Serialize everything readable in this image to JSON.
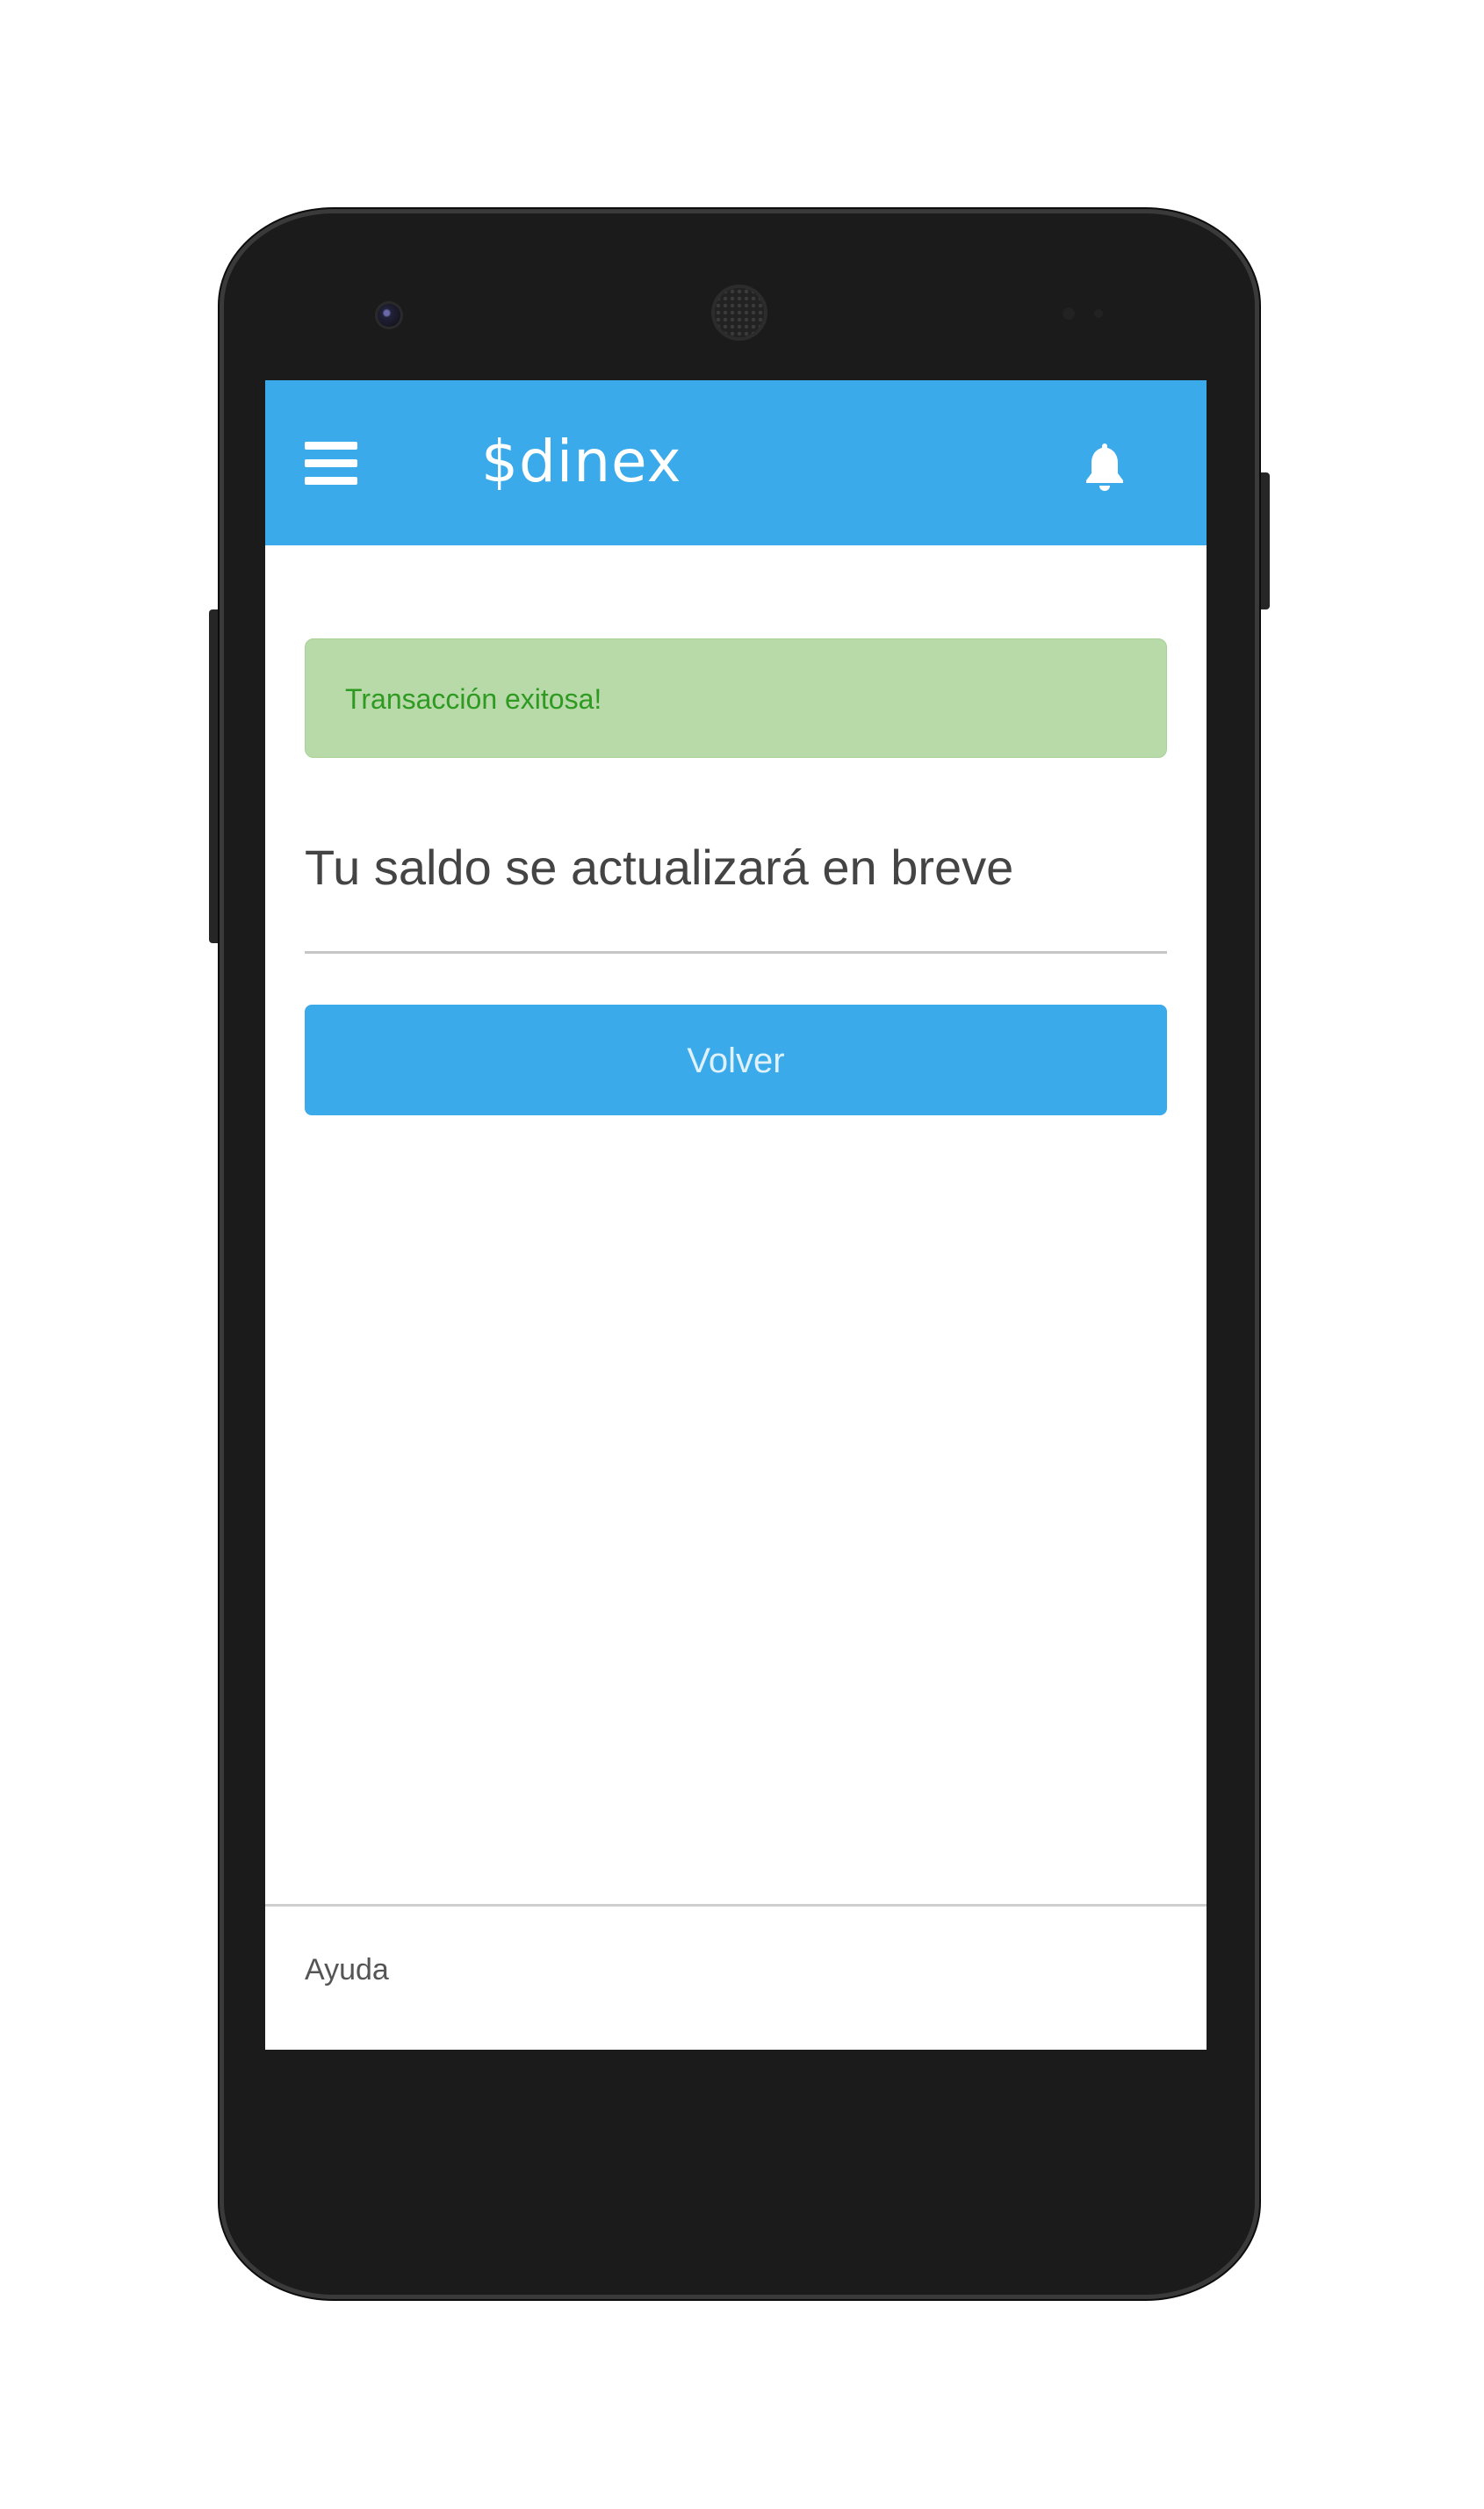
{
  "app": {
    "brand": "$dinex"
  },
  "header": {
    "menu_icon": "hamburger-menu-icon",
    "notifications_icon": "bell-icon",
    "bar_color": "#3aaaea"
  },
  "alert": {
    "message": "Transacción exitosa!",
    "background_color": "#b7daa8",
    "text_color": "#2f9a22"
  },
  "main": {
    "subtitle": "Tu saldo se actualizará en breve",
    "back_button_label": "Volver"
  },
  "footer": {
    "help_label": "Ayuda"
  }
}
